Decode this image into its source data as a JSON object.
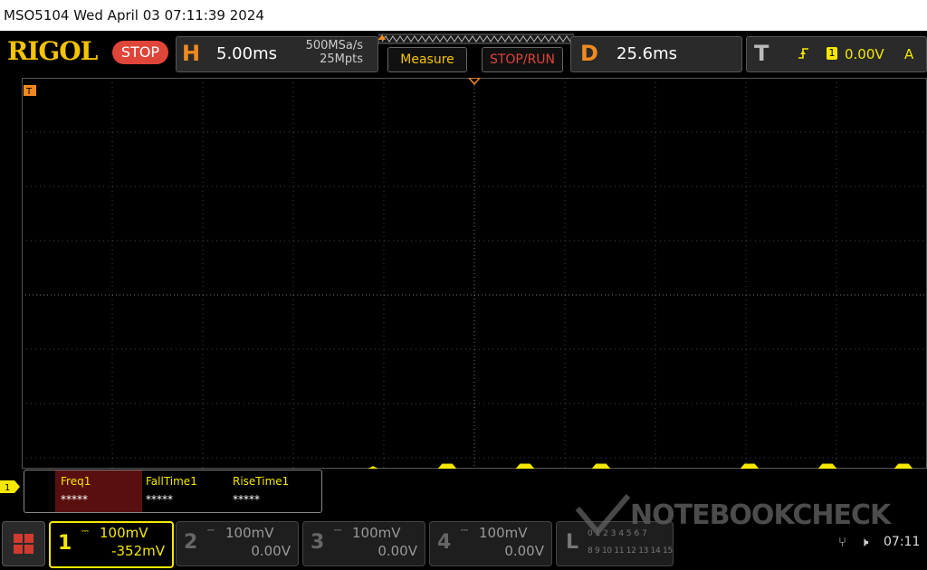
{
  "titlebar": {
    "text": "MSO5104  Wed April 03 07:11:39 2024"
  },
  "topbar": {
    "logo": "RIGOL",
    "run_state": "STOP",
    "horizontal": {
      "letter": "H",
      "timebase": "5.00ms",
      "sample_rate": "500MSa/s",
      "memory": "25Mpts"
    },
    "measure_label": "Measure",
    "stop_run_label": "STOP/RUN",
    "delay": {
      "letter": "D",
      "value": "25.6ms"
    },
    "trigger": {
      "letter": "T",
      "source": "1",
      "level": "0.00V",
      "mode": "A",
      "marker": "T"
    }
  },
  "colors": {
    "ch1": "#f5e800",
    "accent": "#f08a20",
    "stop": "#e0453a"
  },
  "waveform": {
    "channel_marker": "1"
  },
  "measurements": [
    {
      "name": "Freq1",
      "value": "*****"
    },
    {
      "name": "FallTime1",
      "value": "*****"
    },
    {
      "name": "RiseTime1",
      "value": "*****"
    }
  ],
  "channels": [
    {
      "num": "1",
      "scale": "100mV",
      "offset": "-352mV"
    },
    {
      "num": "2",
      "scale": "100mV",
      "offset": "0.00V"
    },
    {
      "num": "3",
      "scale": "100mV",
      "offset": "0.00V"
    },
    {
      "num": "4",
      "scale": "100mV",
      "offset": "0.00V"
    }
  ],
  "logic": {
    "letter": "L",
    "row1": "0 1 2 3 4 5 6 7",
    "row2": "8 9 10 11 12 13 14 15"
  },
  "watermark": "NOTEBOOKCHECK",
  "status": {
    "usb_icon": "usb-icon",
    "sound_icon": "sound-icon",
    "time": "07:11"
  }
}
